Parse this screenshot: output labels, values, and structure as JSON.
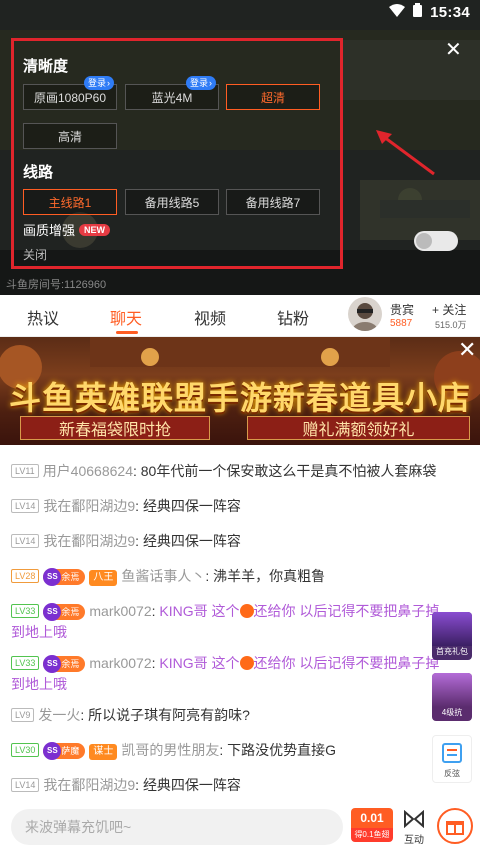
{
  "status_bar": {
    "time": "15:34"
  },
  "quality_panel": {
    "title": "清晰度",
    "options": [
      "原画1080P60",
      "蓝光4M",
      "超清",
      "高清"
    ],
    "selected": "超清",
    "login_badge": "登录",
    "route_title": "线路",
    "routes": [
      "主线路1",
      "备用线路5",
      "备用线路7"
    ],
    "selected_route": "主线路1",
    "enhance_label": "画质增强",
    "enhance_badge": "NEW",
    "enhance_state": "关闭"
  },
  "video": {
    "room_caption": "斗鱼房间号:1126960"
  },
  "tabs": [
    "热议",
    "聊天",
    "视频",
    "钻粉"
  ],
  "active_tab": "聊天",
  "anchor": {
    "name": "贵宾",
    "rank": "5887",
    "follow_label": "+ 关注",
    "followers": "515.0万"
  },
  "banner": {
    "title": "斗鱼英雄联盟手游新春道具小店",
    "left_text": "新春福袋限时抢",
    "right_text": "赠礼满额领好礼"
  },
  "chat": [
    {
      "level": "LV11",
      "user": "用户40668624",
      "text": "80年代前一个保安敢这么干是真不怕被人套麻袋"
    },
    {
      "level": "LV14",
      "user": "我在鄱阳湖边9",
      "text": "经典四保一阵容"
    },
    {
      "level": "LV14",
      "user": "我在鄱阳湖边9",
      "text": "经典四保一阵容"
    },
    {
      "level": "LV28",
      "fan": "余焉",
      "noble": "八王",
      "user": "鱼酱话事人丶",
      "text": "沸羊羊，你真粗鲁"
    },
    {
      "level": "LV33",
      "fan": "余焉",
      "user": "mark0072",
      "text1": "KING哥 这个",
      "text2": "还给你 以后记得不要把鼻子掉",
      "text3": "到地上哦"
    },
    {
      "level": "LV33",
      "fan": "余焉",
      "user": "mark0072",
      "text1": "KING哥 这个",
      "text2": "还给你 以后记得不要把鼻子掉",
      "text3": "到地上哦"
    },
    {
      "level": "LV9",
      "user": "发一火",
      "text": "所以说子琪有阿亮有韵味?"
    },
    {
      "level": "LV30",
      "fan": "萨魔",
      "noble": "谋士",
      "user": "凯哥的男性朋友",
      "text": "下路没优势直接G"
    },
    {
      "level": "LV14",
      "user": "我在鄱阳湖边9",
      "text": "经典四保一阵容"
    }
  ],
  "side_widgets": [
    "首充礼包",
    "4级抗",
    "反弦"
  ],
  "input": {
    "placeholder": "来波弹幕充饥吧~"
  },
  "promo": {
    "price": "0.01",
    "sub": "得0.1鱼翅"
  },
  "interact_label": "互动"
}
